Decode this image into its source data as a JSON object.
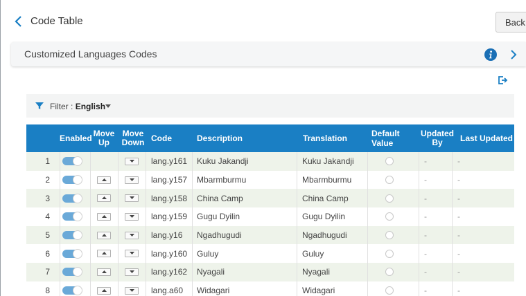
{
  "header": {
    "title": "Code Table",
    "back_label": "Back"
  },
  "banner": {
    "title": "Customized Languages Codes"
  },
  "filter": {
    "label": "Filter :",
    "value": "English"
  },
  "table": {
    "columns": {
      "enabled": "Enabled",
      "move_up": "Move Up",
      "move_down": "Move Down",
      "code": "Code",
      "description": "Description",
      "translation": "Translation",
      "default_value": "Default Value",
      "updated_by": "Updated By",
      "last_updated": "Last Updated"
    },
    "rows": [
      {
        "num": "1",
        "code": "lang.y161",
        "description": "Kuku Jakandji",
        "translation": "Kuku Jakandji",
        "updated_by": "-",
        "last_updated": "-"
      },
      {
        "num": "2",
        "code": "lang.y157",
        "description": "Mbarmburmu",
        "translation": "Mbarmburmu",
        "updated_by": "-",
        "last_updated": "-"
      },
      {
        "num": "3",
        "code": "lang.y158",
        "description": "China Camp",
        "translation": "China Camp",
        "updated_by": "-",
        "last_updated": "-"
      },
      {
        "num": "4",
        "code": "lang.y159",
        "description": "Gugu Dyilin",
        "translation": "Gugu Dyilin",
        "updated_by": "-",
        "last_updated": "-"
      },
      {
        "num": "5",
        "code": "lang.y16",
        "description": "Ngadhugudi",
        "translation": "Ngadhugudi",
        "updated_by": "-",
        "last_updated": "-"
      },
      {
        "num": "6",
        "code": "lang.y160",
        "description": "Guluy",
        "translation": "Guluy",
        "updated_by": "-",
        "last_updated": "-"
      },
      {
        "num": "7",
        "code": "lang.y162",
        "description": "Nyagali",
        "translation": "Nyagali",
        "updated_by": "-",
        "last_updated": "-"
      },
      {
        "num": "8",
        "code": "lang.a60",
        "description": "Widagari",
        "translation": "Widagari",
        "updated_by": "-",
        "last_updated": "-"
      }
    ]
  },
  "colors": {
    "accent": "#1a7fc4",
    "row_alt": "#eef3ea",
    "toggle": "#6aa9d8"
  },
  "icons": [
    "chevron-left-icon",
    "info-icon",
    "chevron-right-icon",
    "export-icon",
    "filter-icon",
    "caret-down-icon",
    "arrow-up-icon",
    "arrow-down-icon"
  ]
}
